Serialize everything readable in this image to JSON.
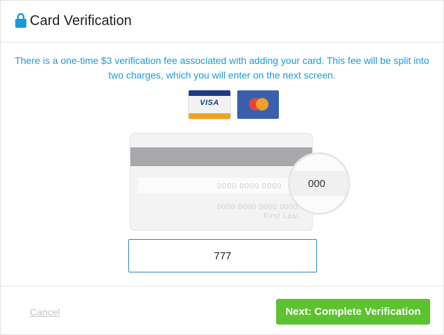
{
  "header": {
    "title": "Card Verification",
    "icon": "lock-icon"
  },
  "notice": "There is a one-time $3 verification fee associated with adding your card. This fee will be split into two charges, which you will enter on the next screen.",
  "card_logos": {
    "visa_label": "VISA",
    "mastercard_icon": "mastercard-icon"
  },
  "card_illustration": {
    "signature_digits": "0000  0000  0000",
    "card_number": "0000 0000 0000 0000",
    "name": "First  Last",
    "cvv_zoom": "000"
  },
  "cvv_field": {
    "value": "777"
  },
  "footer": {
    "cancel_label": "Cancel",
    "next_label": "Next: Complete Verification"
  },
  "colors": {
    "accent": "#1a9ad6",
    "primary_button": "#5cc22f",
    "input_border": "#2a86c8"
  }
}
